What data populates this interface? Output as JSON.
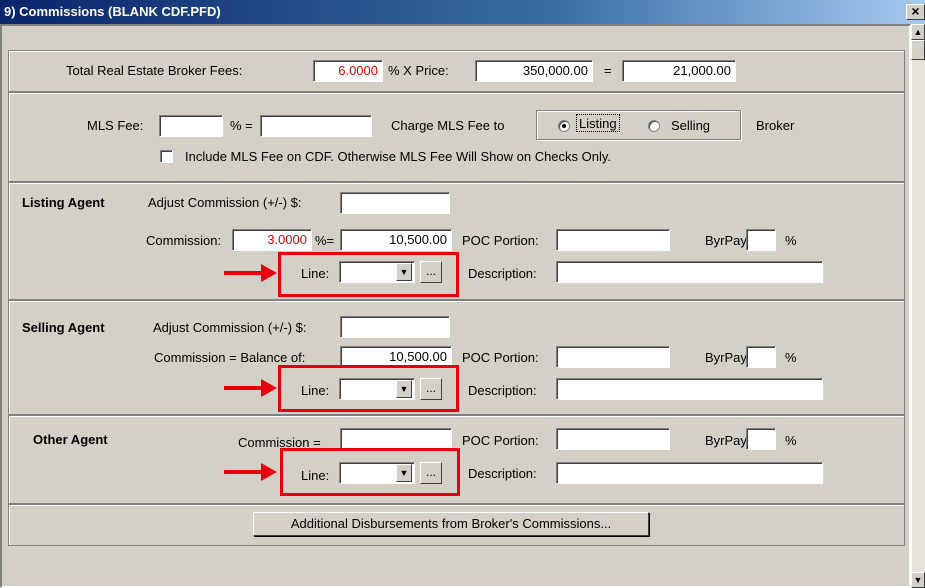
{
  "window": {
    "title": "9) Commissions (BLANK CDF.PFD)",
    "close": "×"
  },
  "broker_fees": {
    "label": "Total Real Estate Broker Fees:",
    "percent": "6.0000",
    "times_label": "% X  Price:",
    "price": "350,000.00",
    "equals": "=",
    "total": "21,000.00"
  },
  "mls": {
    "fee_label": "MLS Fee:",
    "percent_value": "",
    "pct_eq": "% =",
    "amount": "",
    "charge_label": "Charge MLS Fee to",
    "option_listing": "Listing",
    "option_selling": "Selling",
    "broker_label": "Broker",
    "selected": "Listing",
    "include_label": "Include MLS Fee on CDF. Otherwise MLS Fee Will Show on Checks Only.",
    "include_checked": false
  },
  "listing": {
    "title": "Listing Agent",
    "adjust_label": "Adjust Commission (+/-) $:",
    "adjust_value": "",
    "commission_label": "Commission:",
    "percent": "3.0000",
    "pct_eq": "%=",
    "amount": "10,500.00",
    "poc_label": "POC Portion:",
    "poc_value": "",
    "byrpay_label": "ByrPay:",
    "byrpay_value": "",
    "pct": "%",
    "line_label": "Line:",
    "line_value": "",
    "ellipsis": "...",
    "desc_label": "Description:",
    "desc_value": ""
  },
  "selling": {
    "title": "Selling Agent",
    "adjust_label": "Adjust Commission (+/-) $:",
    "adjust_value": "",
    "commission_label": "Commission = Balance of:",
    "amount": "10,500.00",
    "poc_label": "POC Portion:",
    "poc_value": "",
    "byrpay_label": "ByrPay:",
    "byrpay_value": "",
    "pct": "%",
    "line_label": "Line:",
    "line_value": "",
    "ellipsis": "...",
    "desc_label": "Description:",
    "desc_value": ""
  },
  "other": {
    "title": "Other Agent",
    "commission_label": "Commission =",
    "amount": "",
    "poc_label": "POC Portion:",
    "poc_value": "",
    "byrpay_label": "ByrPay:",
    "byrpay_value": "",
    "pct": "%",
    "line_label": "Line:",
    "line_value": "",
    "ellipsis": "...",
    "desc_label": "Description:",
    "desc_value": ""
  },
  "footer": {
    "button": "Additional Disbursements from Broker's Commissions..."
  },
  "colors": {
    "highlight": "#e8000f",
    "red_text": "#e00000",
    "titlebar": "#0a246a"
  }
}
